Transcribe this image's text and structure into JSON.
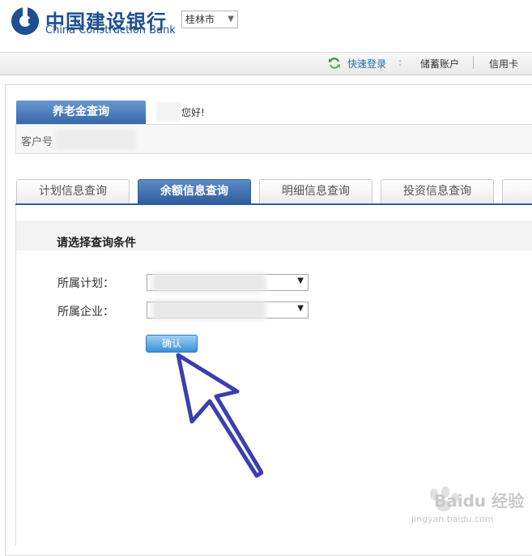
{
  "header": {
    "brand_cn": "中国建设银行",
    "brand_en": "China Construction Bank",
    "city": "桂林市",
    "brand_color": "#1d4f91"
  },
  "topnav": {
    "quick_login": "快速登录",
    "separator": ":",
    "savings": "储蓄账户",
    "credit": "信用卡"
  },
  "pension": {
    "tab_label": "养老金查询",
    "greeting": "您好!",
    "customer_label": "客户号"
  },
  "tabs": [
    {
      "label": "计划信息查询",
      "active": false
    },
    {
      "label": "余额信息查询",
      "active": true
    },
    {
      "label": "明细信息查询",
      "active": false
    },
    {
      "label": "投资信息查询",
      "active": false
    }
  ],
  "form": {
    "section_title": "请选择查询条件",
    "plan_label": "所属计划：",
    "company_label": "所属企业：",
    "confirm": "确认"
  },
  "watermark": {
    "text": "Baidu 经验",
    "url": "jingyan.baidu.com"
  },
  "colors": {
    "accent": "#2e5e9e",
    "arrow": "#3a3fb0",
    "link": "#1e6fb5"
  }
}
